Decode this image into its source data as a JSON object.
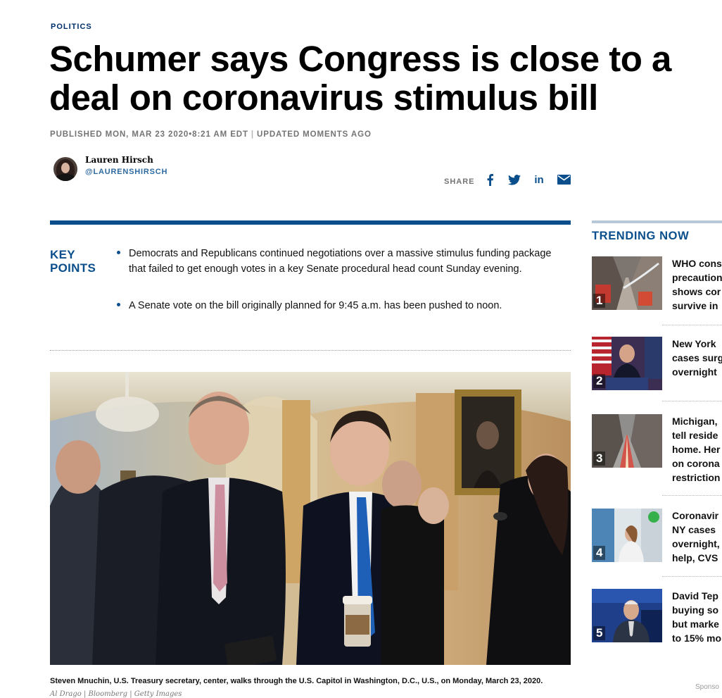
{
  "article": {
    "section": "POLITICS",
    "headline": "Schumer says Congress is close to a deal on coronavirus stimulus bill",
    "published": "PUBLISHED MON, MAR 23 2020•8:21 AM EDT",
    "divider": "|",
    "updated": "UPDATED MOMENTS AGO",
    "author": {
      "name": "Lauren Hirsch",
      "handle": "@LAURENSHIRSCH"
    },
    "share": {
      "label": "SHARE",
      "icons": [
        "facebook-icon",
        "twitter-icon",
        "linkedin-icon",
        "email-icon"
      ]
    },
    "key_points": {
      "title": "KEY POINTS",
      "items": [
        "Democrats and Republicans continued negotiations over a massive stimulus funding package that failed to get enough votes in a key Senate procedural head count Sunday evening.",
        "A Senate vote on the bill originally planned for 9:45 a.m. has been pushed to noon."
      ]
    },
    "photo": {
      "caption": "Steven Mnuchin, U.S. Treasury secretary, center, walks through the U.S. Capitol in Washington, D.C., U.S., on Monday, March 23, 2020.",
      "credit": "Al Drago | Bloomberg | Getty Images"
    }
  },
  "trending": {
    "title": "TRENDING NOW",
    "items": [
      {
        "num": "1",
        "title": "WHO cons\nprecaution\nshows cor\nsurvive in"
      },
      {
        "num": "2",
        "title": "New York\ncases surg\novernight"
      },
      {
        "num": "3",
        "title": "Michigan,\ntell reside\nhome. Her\non corona\nrestriction"
      },
      {
        "num": "4",
        "title": "Coronavir\nNY cases\novernight,\nhelp, CVS"
      },
      {
        "num": "5",
        "title": "David Tep\nbuying so\nbut marke\nto 15% mo"
      }
    ]
  },
  "sponsor": "Sponso",
  "colors": {
    "brand_blue": "#0a4f8c",
    "kicker_navy": "#002f6c",
    "meta_gray": "#747474"
  }
}
